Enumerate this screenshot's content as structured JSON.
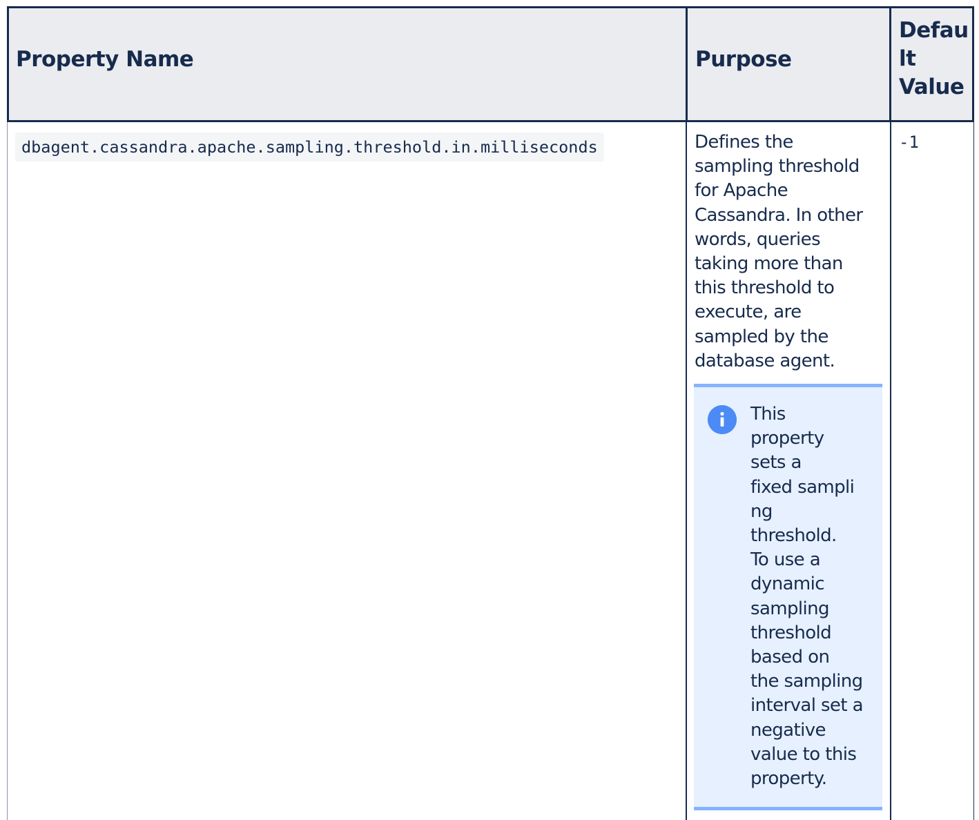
{
  "table": {
    "headers": {
      "property_name": "Property Name",
      "purpose": "Purpose",
      "default_value_lines": [
        "Defau",
        "lt",
        "Value"
      ]
    },
    "rows": [
      {
        "property_name": "dbagent.cassandra.apache.sampling.threshold.in.milliseconds",
        "purpose": "Defines the\nsampling threshold\nfor Apache\nCassandra. In other\nwords, queries\ntaking more than\nthis threshold to\nexecute, are\nsampled by the\ndatabase agent.",
        "note": {
          "icon": "info-icon",
          "text": "This\nproperty\nsets a\nfixed sampli\nng\nthreshold.\nTo use a\ndynamic\nsampling\nthreshold\nbased on\nthe sampling\ninterval set a\nnegative\nvalue to this\nproperty."
        },
        "default_value": "-1"
      }
    ]
  },
  "colors": {
    "header_bg": "#ebecf0",
    "border": "#172b4d",
    "code_bg": "#f4f5f7",
    "note_bg": "#e6f0ff",
    "note_border": "#85b3ff",
    "info_icon": "#4c8bf5"
  }
}
